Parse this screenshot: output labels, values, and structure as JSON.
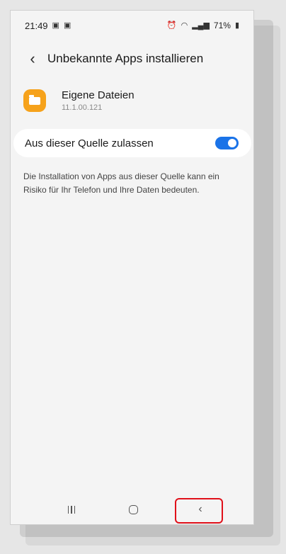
{
  "status_bar": {
    "time": "21:49",
    "battery": "71%",
    "left_icons": [
      "gallery-icon",
      "image-icon"
    ],
    "right_icons": [
      "alarm-icon",
      "wifi-icon",
      "signal-icon",
      "battery-icon"
    ]
  },
  "header": {
    "title": "Unbekannte Apps installieren",
    "back_icon": "chevron-left-icon"
  },
  "app": {
    "name": "Eigene Dateien",
    "version": "11.1.00.121",
    "icon": "folder-icon",
    "icon_color": "#f6a21b"
  },
  "setting": {
    "label": "Aus dieser Quelle zulassen",
    "enabled": true,
    "accent_color": "#1a73e8"
  },
  "description": "Die Installation von Apps aus dieser Quelle kann ein Risiko für Ihr Telefon und Ihre Daten bedeuten.",
  "nav_bar": {
    "buttons": [
      "recent-apps-icon",
      "home-icon",
      "back-icon"
    ],
    "highlight_color": "#e0101a"
  }
}
